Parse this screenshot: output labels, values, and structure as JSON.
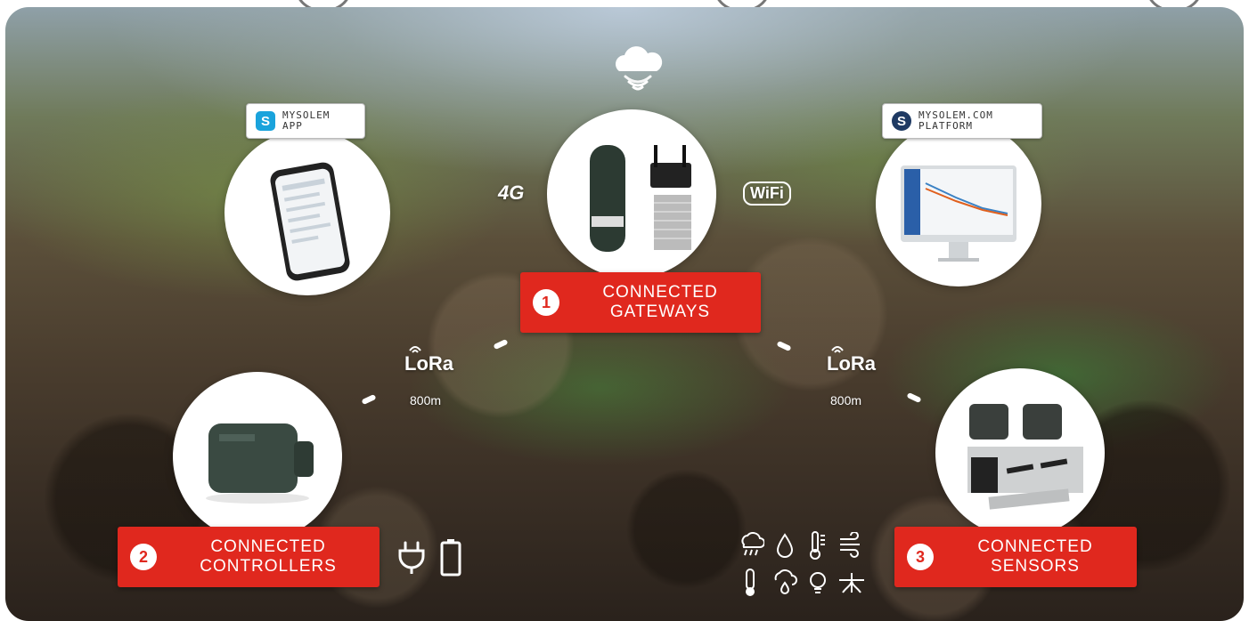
{
  "app_tag": {
    "line1": "MYSOLEM",
    "line2": "APP"
  },
  "platform_tag": {
    "line1": "MYSOLEM.COM",
    "line2": "PLATFORM"
  },
  "gateways": {
    "number": "1",
    "line1": "CONNECTED",
    "line2": "GATEWAYS"
  },
  "controllers": {
    "number": "2",
    "line1": "CONNECTED",
    "line2": "CONTROLLERS"
  },
  "sensors": {
    "number": "3",
    "line1": "CONNECTED",
    "line2": "SENSORS"
  },
  "network": {
    "fourg": "4G",
    "wifi": "WiFi",
    "lora": "LoRa",
    "range": "800m"
  },
  "colors": {
    "accent_red": "#e0281e",
    "mysolem_blue": "#1aa3dc",
    "platform_navy": "#1f3a63"
  },
  "icons": {
    "power": [
      "plug-icon",
      "battery-icon"
    ],
    "sensors": [
      "rain-icon",
      "water-drop-icon",
      "soil-thermometer-icon",
      "wind-icon",
      "thermometer-icon",
      "humidity-icon",
      "light-bulb-icon",
      "root-icon"
    ]
  }
}
